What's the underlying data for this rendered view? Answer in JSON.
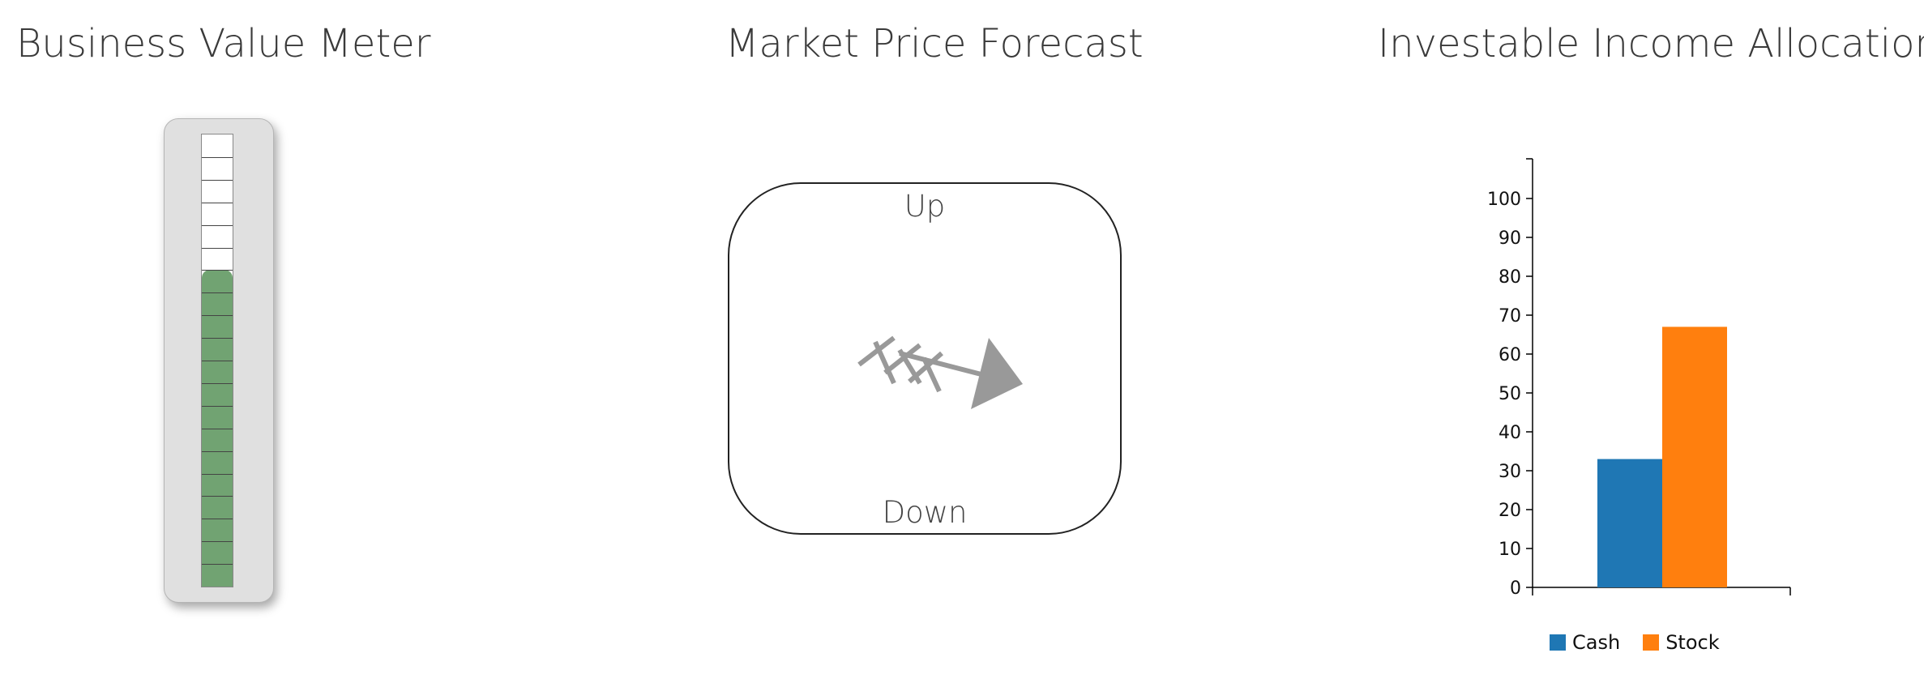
{
  "titles": {
    "meter": "Business Value Meter",
    "forecast": "Market Price Forecast",
    "allocation": "Investable Income Allocation"
  },
  "meter": {
    "segments": 20,
    "filled_segments": 14,
    "fill_color": "#71a372"
  },
  "forecast": {
    "up_label": "Up",
    "down_label": "Down",
    "direction": "down",
    "arrow_color": "#999999"
  },
  "chart_data": {
    "type": "bar",
    "title": "Investable Income Allocation",
    "categories": [
      "Cash",
      "Stock"
    ],
    "values": [
      33,
      67
    ],
    "colors": [
      "#1f77b4",
      "#ff7f0e"
    ],
    "ylim": [
      0,
      100
    ],
    "yticks": [
      0,
      10,
      20,
      30,
      40,
      50,
      60,
      70,
      80,
      90,
      100
    ],
    "legend": [
      "Cash",
      "Stock"
    ],
    "legend_position": "bottom",
    "grid": false
  }
}
